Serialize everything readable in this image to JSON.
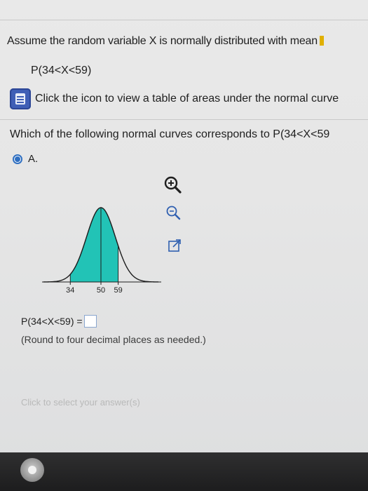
{
  "question": {
    "text": "Assume the random variable X is normally distributed with mean",
    "expression": "P(34<X<59)"
  },
  "table_link": {
    "label": "Click the icon to view a table of areas under the normal curve"
  },
  "prompt": {
    "text": "Which of the following normal curves corresponds to P(34<X<59"
  },
  "option": {
    "label": "A.",
    "selected": true
  },
  "toolbar": {
    "zoom_in_icon": "zoom-in-icon",
    "zoom_out_icon": "zoom-out-icon",
    "popout_icon": "popout-icon"
  },
  "chart_data": {
    "type": "area",
    "ticks": [
      "34",
      "50",
      "59"
    ],
    "x_values": [
      34,
      50,
      59
    ],
    "mean": 50,
    "shaded_range": [
      34,
      59
    ],
    "fill_color": "#22c3b6"
  },
  "answer": {
    "expression": "P(34<X<59) =",
    "value": ""
  },
  "hint": "(Round to four decimal places as needed.)",
  "select_message": "Click to select your answer(s)"
}
